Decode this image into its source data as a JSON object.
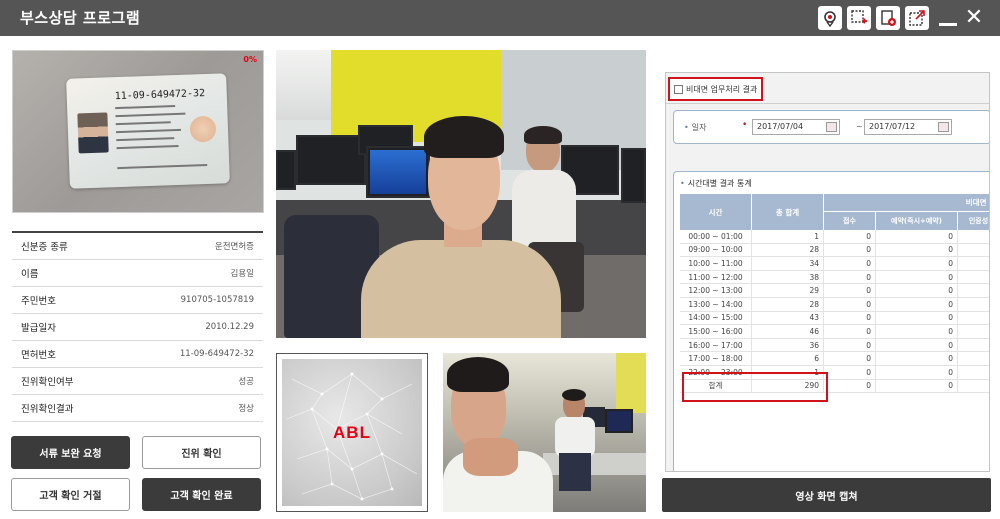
{
  "app": {
    "title": "부스상담 프로그램"
  },
  "id_card": {
    "progress_label": "0%",
    "license_number": "11-09-649472-32"
  },
  "info": {
    "rows": [
      {
        "label": "신분증 종류",
        "value": "운전면허증"
      },
      {
        "label": "이름",
        "value": "김용일"
      },
      {
        "label": "주민번호",
        "value": "910705-1057819"
      },
      {
        "label": "발급일자",
        "value": "2010.12.29"
      },
      {
        "label": "면허번호",
        "value": "11-09-649472-32"
      },
      {
        "label": "진위확인여부",
        "value": "성공"
      },
      {
        "label": "진위확인결과",
        "value": "정상"
      }
    ]
  },
  "buttons": {
    "doc_request": "서류 보완 요청",
    "verify": "진위 확인",
    "reject": "고객 확인 거절",
    "confirm": "고객 확인 완료",
    "capture": "영상 화면 캡쳐"
  },
  "logo": {
    "text": "ABL",
    "color": "#e60012"
  },
  "results": {
    "title": "비대면 업무처리 결과",
    "date_label": "일자",
    "date_from": "2017/07/04",
    "date_to": "2017/07/12",
    "date_sep": "~",
    "table_title": "시간대별 결과 통계",
    "headers": {
      "time": "시간",
      "total": "총 합계",
      "group": "비대면 업",
      "sub": [
        "접수",
        "예약(즉시+예약)",
        "인증성"
      ]
    },
    "rows": [
      {
        "time": "00:00 ~ 01:00",
        "total": "1",
        "a": "0",
        "b": "0"
      },
      {
        "time": "09:00 ~ 10:00",
        "total": "28",
        "a": "0",
        "b": "0"
      },
      {
        "time": "10:00 ~ 11:00",
        "total": "34",
        "a": "0",
        "b": "0"
      },
      {
        "time": "11:00 ~ 12:00",
        "total": "38",
        "a": "0",
        "b": "0"
      },
      {
        "time": "12:00 ~ 13:00",
        "total": "29",
        "a": "0",
        "b": "0"
      },
      {
        "time": "13:00 ~ 14:00",
        "total": "28",
        "a": "0",
        "b": "0"
      },
      {
        "time": "14:00 ~ 15:00",
        "total": "43",
        "a": "0",
        "b": "0"
      },
      {
        "time": "15:00 ~ 16:00",
        "total": "46",
        "a": "0",
        "b": "0"
      },
      {
        "time": "16:00 ~ 17:00",
        "total": "36",
        "a": "0",
        "b": "0"
      },
      {
        "time": "17:00 ~ 18:00",
        "total": "6",
        "a": "0",
        "b": "0"
      },
      {
        "time": "22:00 ~ 23:00",
        "total": "1",
        "a": "0",
        "b": "0"
      }
    ],
    "sum": {
      "label": "합계",
      "total": "290",
      "a": "0",
      "b": "0"
    }
  },
  "colors": {
    "titlebar": "#555555",
    "dark_button": "#3b3b3b",
    "highlight": "#d0121b",
    "table_header": "#a6b9d1"
  }
}
